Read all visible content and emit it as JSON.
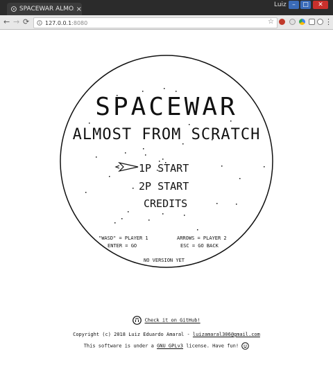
{
  "browser": {
    "tab_title": "SPACEWAR ALMO...",
    "tab_close": "×",
    "user": "Luiz",
    "url_host": "127.0.0.1",
    "url_port": ":8080",
    "back": "←",
    "forward": "→",
    "reload": "⟳",
    "star": "☆",
    "menu": "⋮",
    "minimize": "–",
    "maximize": "□",
    "close": "✕"
  },
  "game": {
    "title": "SPACEWAR",
    "subtitle": "ALMOST FROM SCRATCH",
    "menu": [
      {
        "label": "1P START",
        "selected": true
      },
      {
        "label": "2P START",
        "selected": false
      },
      {
        "label": "CREDITS",
        "selected": false
      }
    ],
    "controls": {
      "p1_keys": "\"WASD\" = PLAYER 1",
      "enter": "ENTER = GO",
      "p2_keys": "ARROWS = PLAYER 2",
      "esc": "ESC = GO BACK"
    },
    "version": "NO VERSION YET"
  },
  "footer": {
    "github_text": "Check it on GitHub!",
    "copyright_prefix": "Copyright (c) 2018 Luiz Eduardo Amaral - ",
    "email": "luizamaral306@gmail.com",
    "license_prefix": "This software is under a ",
    "license_name": "GNU GPLv3",
    "license_suffix": " license. Have fun! "
  },
  "colors": {
    "ink": "#111111",
    "background": "#ffffff",
    "chrome_dark": "#2b2b2b",
    "toolbar": "#e8e8e8",
    "close_red": "#c9302c",
    "window_blue": "#3a6bb8"
  },
  "icons": [
    "site-icon",
    "github-icon",
    "smile-icon",
    "ship-cursor-icon",
    "star-icon"
  ]
}
